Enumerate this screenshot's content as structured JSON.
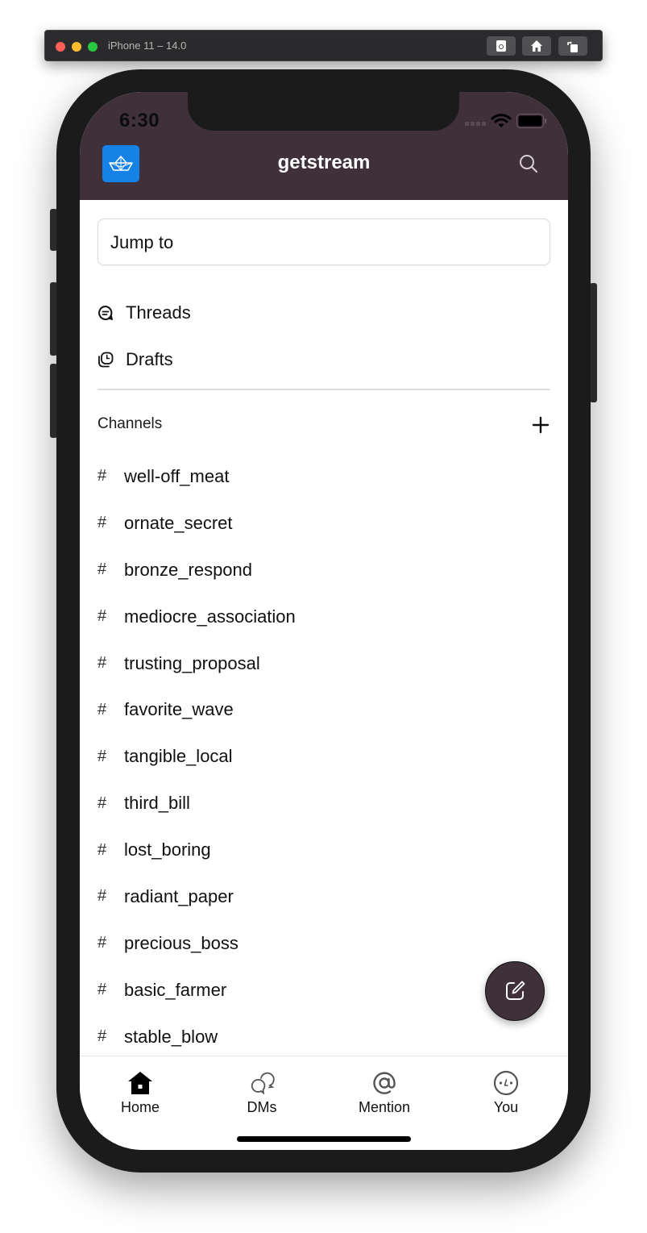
{
  "simulator": {
    "title": "iPhone 11 – 14.0",
    "buttons": [
      "screenshot",
      "home",
      "rotate"
    ]
  },
  "status_bar": {
    "time": "6:30"
  },
  "header": {
    "title": "getstream",
    "logo": "boat-logo-icon",
    "search_icon": "search-icon",
    "background_color": "#3f3039",
    "logo_color": "#1582e8"
  },
  "jump_to": {
    "placeholder": "Jump to"
  },
  "nav": [
    {
      "label": "Threads",
      "icon": "threads-icon"
    },
    {
      "label": "Drafts",
      "icon": "drafts-icon"
    }
  ],
  "channels": {
    "header": "Channels",
    "add_icon": "plus-icon",
    "hash": "#",
    "items": [
      "well-off_meat",
      "ornate_secret",
      "bronze_respond",
      "mediocre_association",
      "trusting_proposal",
      "favorite_wave",
      "tangible_local",
      "third_bill",
      "lost_boring",
      "radiant_paper",
      "precious_boss",
      "basic_farmer",
      "stable_blow"
    ]
  },
  "fab": {
    "icon": "compose-icon"
  },
  "tabbar": [
    {
      "label": "Home",
      "icon": "home-icon",
      "active": true
    },
    {
      "label": "DMs",
      "icon": "dms-icon",
      "active": false
    },
    {
      "label": "Mention",
      "icon": "mention-icon",
      "active": false
    },
    {
      "label": "You",
      "icon": "you-icon",
      "active": false
    }
  ]
}
